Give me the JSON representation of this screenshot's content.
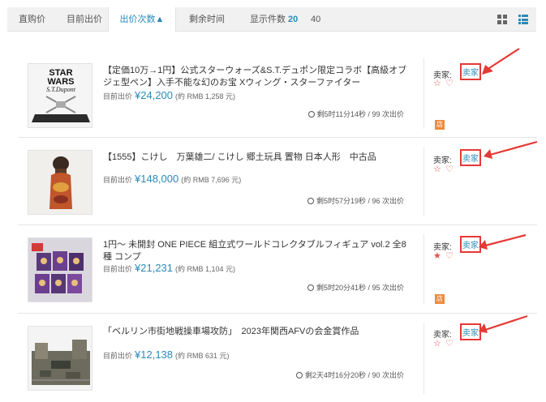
{
  "sort_bar": {
    "items": [
      "直购价",
      "目前出价",
      "出价次数▲",
      "剩余时间"
    ],
    "count_label": "显示件数",
    "count_options": [
      "20",
      "40"
    ],
    "selected_count": "20",
    "view_modes": [
      "grid-view",
      "list-view"
    ],
    "active_view": "list-view",
    "accent_color": "#2a8ab8"
  },
  "listings": [
    {
      "title": "【定価10万→1円】公式スターウォーズ&S.T.デュポン限定コラボ【高級オブジェ型ペン】入手不能な幻のお宝 Xウィング・スターファイター",
      "price_label": "目前出价",
      "price": "¥24,200",
      "rmb": "(約 RMB 1,258 元)",
      "time": "剩5时11分14秒 / 99 次出价",
      "seller_label": "卖家:",
      "seller_link": "卖家",
      "star": "☆",
      "heart": "♡",
      "shop_badge": "店",
      "thumb_text": [
        "STAR",
        "WARS",
        "S.T.Dupont"
      ]
    },
    {
      "title": "【1555】こけし　万葉雄二/ こけし 郷土玩具 置物 日本人形　中古品",
      "price_label": "目前出价",
      "price": "¥148,000",
      "rmb": "(約 RMB 7,696 元)",
      "time": "剩5时57分19秒 / 96 次出价",
      "seller_label": "卖家:",
      "seller_link": "卖家",
      "star": "☆",
      "heart": "♡",
      "shop_badge": ""
    },
    {
      "title": "1円～ 未開封 ONE PIECE 組立式ワールドコレクタブルフィギュア vol.2 全8種 コンプ",
      "price_label": "目前出价",
      "price": "¥21,231",
      "rmb": "(約 RMB 1,104 元)",
      "time": "剩5时20分41秒 / 95 次出价",
      "seller_label": "卖家:",
      "seller_link": "卖家",
      "star": "★",
      "heart": "♡",
      "shop_badge": "店"
    },
    {
      "title": "「ベルリン市街地戦操車場攻防」　2023年関西AFVの会金賞作品",
      "price_label": "目前出价",
      "price": "¥12,138",
      "rmb": "(約 RMB 631 元)",
      "time": "剩2天4时16分20秒 / 90 次出价",
      "seller_label": "卖家:",
      "seller_link": "卖家",
      "star": "☆",
      "heart": "♡",
      "shop_badge": ""
    }
  ]
}
